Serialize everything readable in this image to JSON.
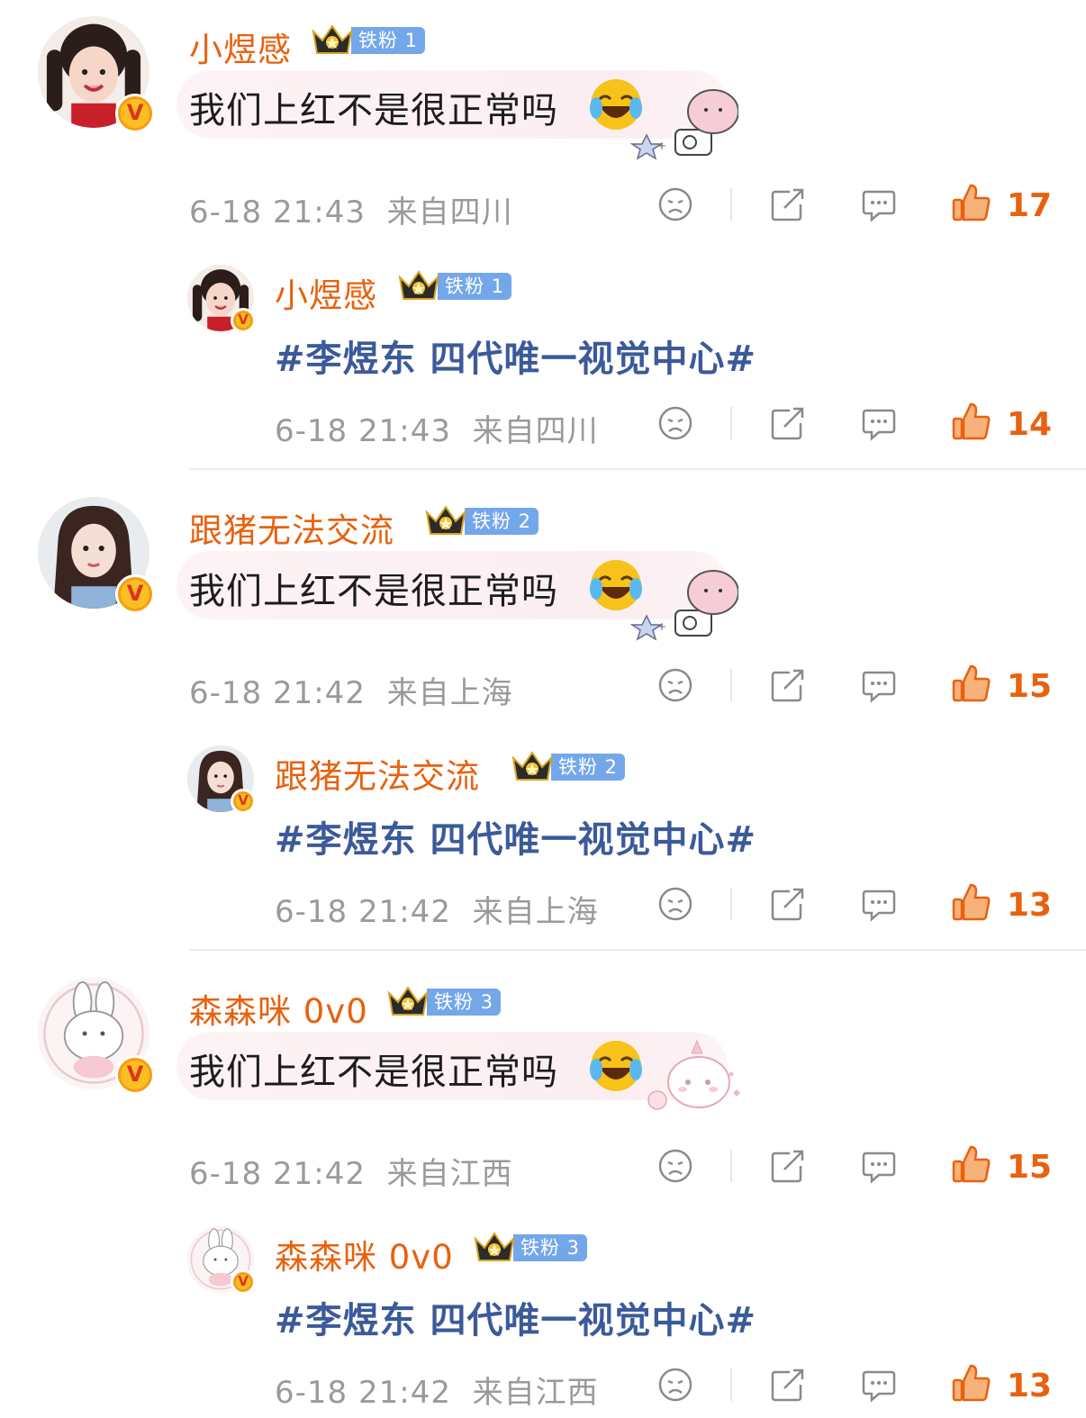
{
  "comments": [
    {
      "username": "小煜感",
      "fan_badge": "铁粉 1",
      "text": "我们上红不是很正常吗",
      "time": "6-18 21:43",
      "location": "来自四川",
      "likes": "17",
      "reply": {
        "username": "小煜感",
        "fan_badge": "铁粉 1",
        "text": "#李煜东 四代唯一视觉中心#",
        "time": "6-18 21:43",
        "location": "来自四川",
        "likes": "14"
      }
    },
    {
      "username": "跟猪无法交流",
      "fan_badge": "铁粉 2",
      "text": "我们上红不是很正常吗",
      "time": "6-18 21:42",
      "location": "来自上海",
      "likes": "15",
      "reply": {
        "username": "跟猪无法交流",
        "fan_badge": "铁粉 2",
        "text": "#李煜东 四代唯一视觉中心#",
        "time": "6-18 21:42",
        "location": "来自上海",
        "likes": "13"
      }
    },
    {
      "username": "森森咪 0v0",
      "fan_badge": "铁粉 3",
      "text": "我们上红不是很正常吗",
      "time": "6-18 21:42",
      "location": "来自江西",
      "likes": "15",
      "reply": {
        "username": "森森咪 0v0",
        "fan_badge": "铁粉 3",
        "text": "#李煜东 四代唯一视觉中心#",
        "time": "6-18 21:42",
        "location": "来自江西",
        "likes": "13"
      }
    }
  ],
  "badge_letter": "V",
  "colors": {
    "username": "#e8610e",
    "topic": "#3b5a9a",
    "meta": "#9a9a9a",
    "fan_badge": "#74a7ea",
    "like": "#e8610e"
  },
  "icons": [
    "dislike-face-icon",
    "share-icon",
    "comment-icon",
    "thumbs-up-icon",
    "crown-icon",
    "laugh-cry-emoji",
    "verified-v-icon"
  ]
}
